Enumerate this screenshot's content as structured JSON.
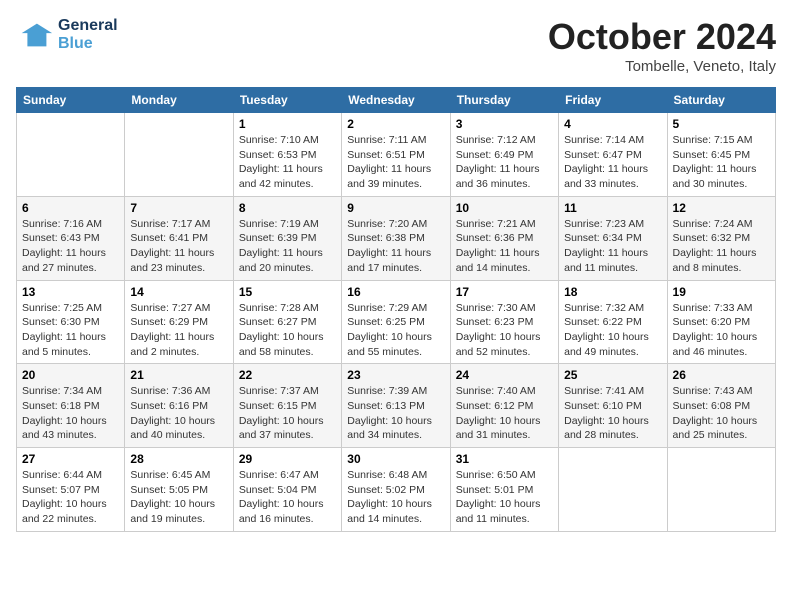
{
  "header": {
    "logo_general": "General",
    "logo_blue": "Blue",
    "month": "October 2024",
    "location": "Tombelle, Veneto, Italy"
  },
  "days_of_week": [
    "Sunday",
    "Monday",
    "Tuesday",
    "Wednesday",
    "Thursday",
    "Friday",
    "Saturday"
  ],
  "weeks": [
    [
      {
        "day": "",
        "info": ""
      },
      {
        "day": "",
        "info": ""
      },
      {
        "day": "1",
        "sunrise": "Sunrise: 7:10 AM",
        "sunset": "Sunset: 6:53 PM",
        "daylight": "Daylight: 11 hours and 42 minutes."
      },
      {
        "day": "2",
        "sunrise": "Sunrise: 7:11 AM",
        "sunset": "Sunset: 6:51 PM",
        "daylight": "Daylight: 11 hours and 39 minutes."
      },
      {
        "day": "3",
        "sunrise": "Sunrise: 7:12 AM",
        "sunset": "Sunset: 6:49 PM",
        "daylight": "Daylight: 11 hours and 36 minutes."
      },
      {
        "day": "4",
        "sunrise": "Sunrise: 7:14 AM",
        "sunset": "Sunset: 6:47 PM",
        "daylight": "Daylight: 11 hours and 33 minutes."
      },
      {
        "day": "5",
        "sunrise": "Sunrise: 7:15 AM",
        "sunset": "Sunset: 6:45 PM",
        "daylight": "Daylight: 11 hours and 30 minutes."
      }
    ],
    [
      {
        "day": "6",
        "sunrise": "Sunrise: 7:16 AM",
        "sunset": "Sunset: 6:43 PM",
        "daylight": "Daylight: 11 hours and 27 minutes."
      },
      {
        "day": "7",
        "sunrise": "Sunrise: 7:17 AM",
        "sunset": "Sunset: 6:41 PM",
        "daylight": "Daylight: 11 hours and 23 minutes."
      },
      {
        "day": "8",
        "sunrise": "Sunrise: 7:19 AM",
        "sunset": "Sunset: 6:39 PM",
        "daylight": "Daylight: 11 hours and 20 minutes."
      },
      {
        "day": "9",
        "sunrise": "Sunrise: 7:20 AM",
        "sunset": "Sunset: 6:38 PM",
        "daylight": "Daylight: 11 hours and 17 minutes."
      },
      {
        "day": "10",
        "sunrise": "Sunrise: 7:21 AM",
        "sunset": "Sunset: 6:36 PM",
        "daylight": "Daylight: 11 hours and 14 minutes."
      },
      {
        "day": "11",
        "sunrise": "Sunrise: 7:23 AM",
        "sunset": "Sunset: 6:34 PM",
        "daylight": "Daylight: 11 hours and 11 minutes."
      },
      {
        "day": "12",
        "sunrise": "Sunrise: 7:24 AM",
        "sunset": "Sunset: 6:32 PM",
        "daylight": "Daylight: 11 hours and 8 minutes."
      }
    ],
    [
      {
        "day": "13",
        "sunrise": "Sunrise: 7:25 AM",
        "sunset": "Sunset: 6:30 PM",
        "daylight": "Daylight: 11 hours and 5 minutes."
      },
      {
        "day": "14",
        "sunrise": "Sunrise: 7:27 AM",
        "sunset": "Sunset: 6:29 PM",
        "daylight": "Daylight: 11 hours and 2 minutes."
      },
      {
        "day": "15",
        "sunrise": "Sunrise: 7:28 AM",
        "sunset": "Sunset: 6:27 PM",
        "daylight": "Daylight: 10 hours and 58 minutes."
      },
      {
        "day": "16",
        "sunrise": "Sunrise: 7:29 AM",
        "sunset": "Sunset: 6:25 PM",
        "daylight": "Daylight: 10 hours and 55 minutes."
      },
      {
        "day": "17",
        "sunrise": "Sunrise: 7:30 AM",
        "sunset": "Sunset: 6:23 PM",
        "daylight": "Daylight: 10 hours and 52 minutes."
      },
      {
        "day": "18",
        "sunrise": "Sunrise: 7:32 AM",
        "sunset": "Sunset: 6:22 PM",
        "daylight": "Daylight: 10 hours and 49 minutes."
      },
      {
        "day": "19",
        "sunrise": "Sunrise: 7:33 AM",
        "sunset": "Sunset: 6:20 PM",
        "daylight": "Daylight: 10 hours and 46 minutes."
      }
    ],
    [
      {
        "day": "20",
        "sunrise": "Sunrise: 7:34 AM",
        "sunset": "Sunset: 6:18 PM",
        "daylight": "Daylight: 10 hours and 43 minutes."
      },
      {
        "day": "21",
        "sunrise": "Sunrise: 7:36 AM",
        "sunset": "Sunset: 6:16 PM",
        "daylight": "Daylight: 10 hours and 40 minutes."
      },
      {
        "day": "22",
        "sunrise": "Sunrise: 7:37 AM",
        "sunset": "Sunset: 6:15 PM",
        "daylight": "Daylight: 10 hours and 37 minutes."
      },
      {
        "day": "23",
        "sunrise": "Sunrise: 7:39 AM",
        "sunset": "Sunset: 6:13 PM",
        "daylight": "Daylight: 10 hours and 34 minutes."
      },
      {
        "day": "24",
        "sunrise": "Sunrise: 7:40 AM",
        "sunset": "Sunset: 6:12 PM",
        "daylight": "Daylight: 10 hours and 31 minutes."
      },
      {
        "day": "25",
        "sunrise": "Sunrise: 7:41 AM",
        "sunset": "Sunset: 6:10 PM",
        "daylight": "Daylight: 10 hours and 28 minutes."
      },
      {
        "day": "26",
        "sunrise": "Sunrise: 7:43 AM",
        "sunset": "Sunset: 6:08 PM",
        "daylight": "Daylight: 10 hours and 25 minutes."
      }
    ],
    [
      {
        "day": "27",
        "sunrise": "Sunrise: 6:44 AM",
        "sunset": "Sunset: 5:07 PM",
        "daylight": "Daylight: 10 hours and 22 minutes."
      },
      {
        "day": "28",
        "sunrise": "Sunrise: 6:45 AM",
        "sunset": "Sunset: 5:05 PM",
        "daylight": "Daylight: 10 hours and 19 minutes."
      },
      {
        "day": "29",
        "sunrise": "Sunrise: 6:47 AM",
        "sunset": "Sunset: 5:04 PM",
        "daylight": "Daylight: 10 hours and 16 minutes."
      },
      {
        "day": "30",
        "sunrise": "Sunrise: 6:48 AM",
        "sunset": "Sunset: 5:02 PM",
        "daylight": "Daylight: 10 hours and 14 minutes."
      },
      {
        "day": "31",
        "sunrise": "Sunrise: 6:50 AM",
        "sunset": "Sunset: 5:01 PM",
        "daylight": "Daylight: 10 hours and 11 minutes."
      },
      {
        "day": "",
        "info": ""
      },
      {
        "day": "",
        "info": ""
      }
    ]
  ]
}
